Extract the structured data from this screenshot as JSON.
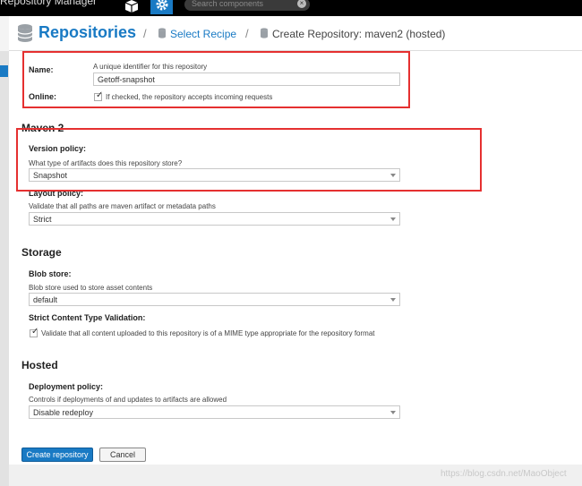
{
  "topbar": {
    "app_title": "Repository Manager",
    "search_placeholder": "Search components"
  },
  "breadcrumb": {
    "root": "Repositories",
    "separator": "/",
    "recipe": "Select Recipe",
    "current": "Create Repository: maven2 (hosted)"
  },
  "form": {
    "name": {
      "label": "Name:",
      "help": "A unique identifier for this repository",
      "value": "Getoff-snapshot"
    },
    "online": {
      "label": "Online:",
      "help": "If checked, the repository accepts incoming requests",
      "checked": true
    },
    "maven2": {
      "heading": "Maven 2",
      "version_policy": {
        "label": "Version policy:",
        "help": "What type of artifacts does this repository store?",
        "value": "Snapshot"
      },
      "layout_policy": {
        "label": "Layout policy:",
        "help": "Validate that all paths are maven artifact or metadata paths",
        "value": "Strict"
      }
    },
    "storage": {
      "heading": "Storage",
      "blob_store": {
        "label": "Blob store:",
        "help": "Blob store used to store asset contents",
        "value": "default"
      },
      "strict_content": {
        "label": "Strict Content Type Validation:",
        "help": "Validate that all content uploaded to this repository is of a MIME type appropriate for the repository format",
        "checked": true
      }
    },
    "hosted": {
      "heading": "Hosted",
      "deployment_policy": {
        "label": "Deployment policy:",
        "help": "Controls if deployments of and updates to artifacts are allowed",
        "value": "Disable redeploy"
      }
    }
  },
  "actions": {
    "create_label": "Create repository",
    "cancel_label": "Cancel"
  },
  "watermark": "https://blog.csdn.net/MaoObject",
  "colors": {
    "accent": "#197ac4",
    "annotation": "#e53030"
  }
}
